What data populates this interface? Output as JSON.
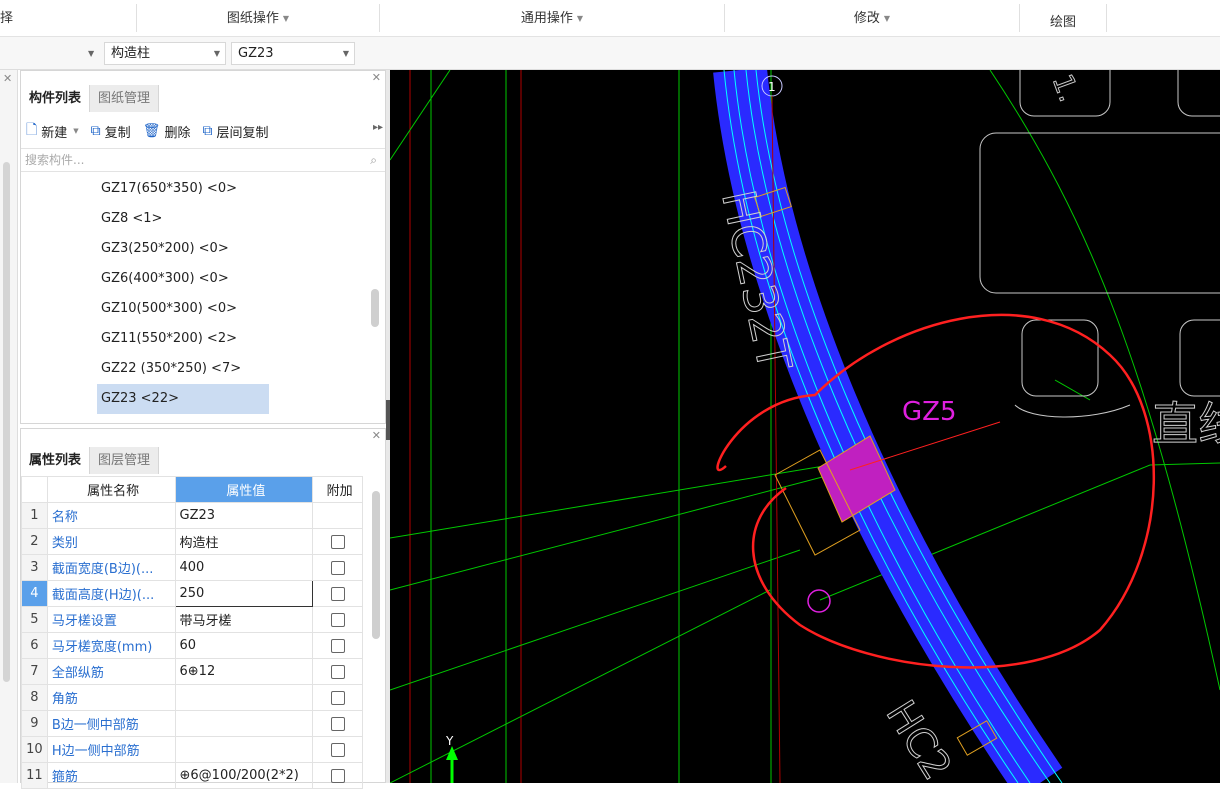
{
  "ribbon": {
    "left_stub": "择",
    "groups": [
      {
        "label": "图纸操作"
      },
      {
        "label": "通用操作"
      },
      {
        "label": "修改"
      },
      {
        "label": "绘图"
      }
    ]
  },
  "selectors": {
    "type": "构造柱",
    "item": "GZ23"
  },
  "component_panel": {
    "tabs": [
      "构件列表",
      "图纸管理"
    ],
    "toolbar": {
      "new": "新建",
      "copy": "复制",
      "delete": "删除",
      "floor_copy": "层间复制"
    },
    "search_placeholder": "搜索构件...",
    "items": [
      "GZ17(650*350) <0>",
      "GZ8 <1>",
      "GZ3(250*200) <0>",
      "GZ6(400*300) <0>",
      "GZ10(500*300) <0>",
      "GZ11(550*200) <2>",
      "GZ22 (350*250)   <7>",
      "GZ23 <22>"
    ],
    "selected_index": 7
  },
  "property_panel": {
    "tabs": [
      "属性列表",
      "图层管理"
    ],
    "columns": [
      "属性名称",
      "属性值",
      "附加"
    ],
    "rows": [
      {
        "no": "1",
        "name": "名称",
        "value": "GZ23",
        "has_check": false
      },
      {
        "no": "2",
        "name": "类别",
        "value": "构造柱",
        "has_check": true
      },
      {
        "no": "3",
        "name": "截面宽度(B边)(...",
        "value": "400",
        "has_check": true
      },
      {
        "no": "4",
        "name": "截面高度(H边)(...",
        "value": "250",
        "has_check": true
      },
      {
        "no": "5",
        "name": "马牙槎设置",
        "value": "带马牙槎",
        "has_check": true
      },
      {
        "no": "6",
        "name": "马牙槎宽度(mm)",
        "value": "60",
        "has_check": true
      },
      {
        "no": "7",
        "name": "全部纵筋",
        "value": "6⊕12",
        "has_check": true
      },
      {
        "no": "8",
        "name": "角筋",
        "value": "",
        "has_check": true
      },
      {
        "no": "9",
        "name": "B边一侧中部筋",
        "value": "",
        "has_check": true
      },
      {
        "no": "10",
        "name": "H边一侧中部筋",
        "value": "",
        "has_check": true
      },
      {
        "no": "11",
        "name": "箍筋",
        "value": "⊕6@100/200(2*2)",
        "has_check": true
      }
    ],
    "editing_row": 3
  },
  "canvas": {
    "labels": {
      "axis_marker": "1",
      "wall_text_top": "HC232T",
      "column_label": "GZ5",
      "right_text": "直线",
      "wall_text_bottom": "HC2",
      "axis_y": "Y"
    },
    "colors": {
      "wall": "#2a2aff",
      "wall_edge": "#00ffff",
      "grid": "#00c800",
      "axis": "#c80000",
      "column": "#e020e0",
      "annotation": "#ff2020",
      "outline": "#d0d0d0"
    }
  }
}
